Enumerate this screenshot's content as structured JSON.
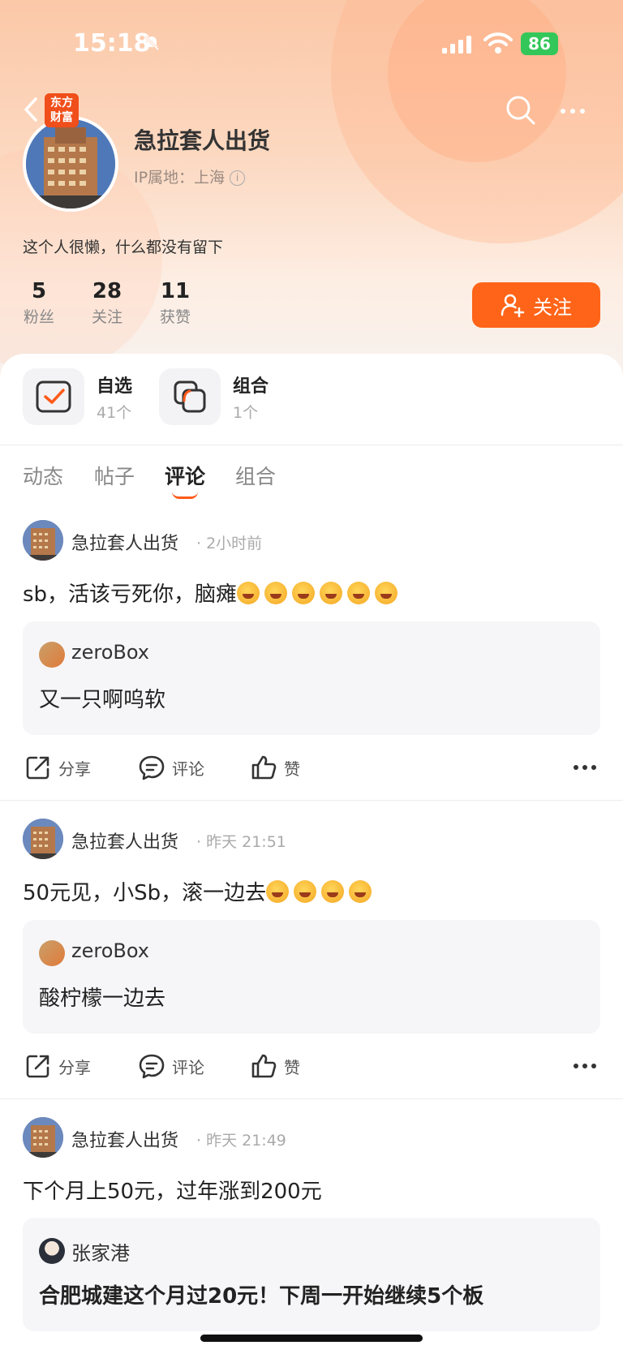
{
  "status_bar": {
    "time": "15:18",
    "battery": "86"
  },
  "header": {
    "badge_text": "东方财富",
    "username": "急拉套人出货",
    "ip_location": "IP属地：上海",
    "bio": "这个人很懒，什么都没有留下"
  },
  "stats": [
    {
      "num": "5",
      "label": "粉丝"
    },
    {
      "num": "28",
      "label": "关注"
    },
    {
      "num": "11",
      "label": "获赞"
    }
  ],
  "follow_label": "关注",
  "tiles": [
    {
      "title": "自选",
      "sub": "41个",
      "icon": "watchlist-check-icon"
    },
    {
      "title": "组合",
      "sub": "1个",
      "icon": "portfolio-icon"
    }
  ],
  "tabs": [
    "动态",
    "帖子",
    "评论",
    "组合"
  ],
  "active_tab": "评论",
  "posts": [
    {
      "author": "急拉套人出货",
      "time": "· 2小时前",
      "text": "sb，活该亏死你，脑瘫",
      "quote_author": "zeroBox",
      "quote_text": "又一只啊呜软"
    },
    {
      "author": "急拉套人出货",
      "time": "· 昨天 21:51",
      "text": "50元见，小Sb，滚一边去",
      "quote_author": "zeroBox",
      "quote_text": "酸柠檬一边去"
    },
    {
      "author": "急拉套人出货",
      "time": "· 昨天 21:49",
      "text": "下个月上50元，过年涨到200元",
      "quote_author": "张家港",
      "quote_text": "合肥城建这个月过20元！下周一开始继续5个板"
    }
  ],
  "actions": {
    "share": "分享",
    "comment": "评论",
    "like": "赞"
  },
  "colors": {
    "accent": "#ff6418",
    "battery": "#33c759"
  }
}
